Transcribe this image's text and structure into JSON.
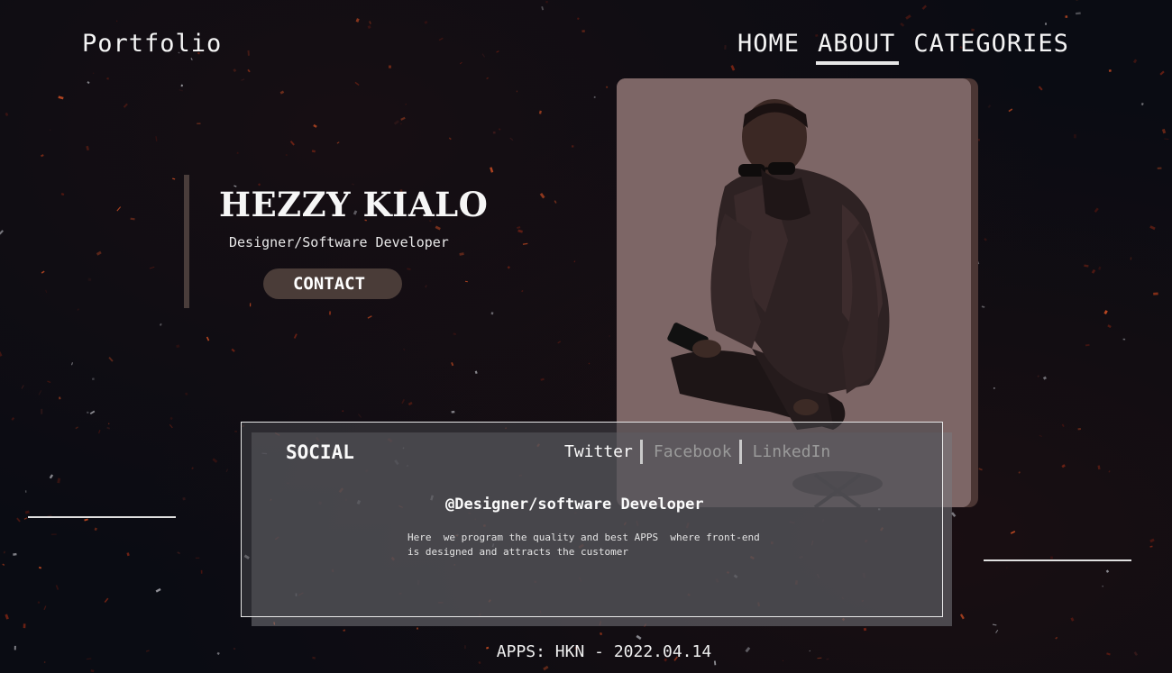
{
  "header": {
    "logo": "Portfolio",
    "nav": [
      "HOME",
      "ABOUT",
      "CATEGORIES"
    ],
    "active_nav": "ABOUT"
  },
  "hero": {
    "name": "HEZZY KIALO",
    "role": "Designer/Software Developer",
    "contact_label": "CONTACT"
  },
  "social": {
    "title": "SOCIAL",
    "tabs": [
      "Twitter",
      "Facebook",
      "LinkedIn"
    ],
    "active_tab": "Twitter",
    "heading": "@Designer/software Developer",
    "body": "Here  we program the quality and best APPS  where front-end\nis designed and attracts the customer"
  },
  "footer": {
    "text": "APPS: HKN - 2022.04.14"
  },
  "colors": {
    "background": "#0a0c13",
    "accent": "#4a3c38",
    "photo_tint": "#7a6262"
  }
}
